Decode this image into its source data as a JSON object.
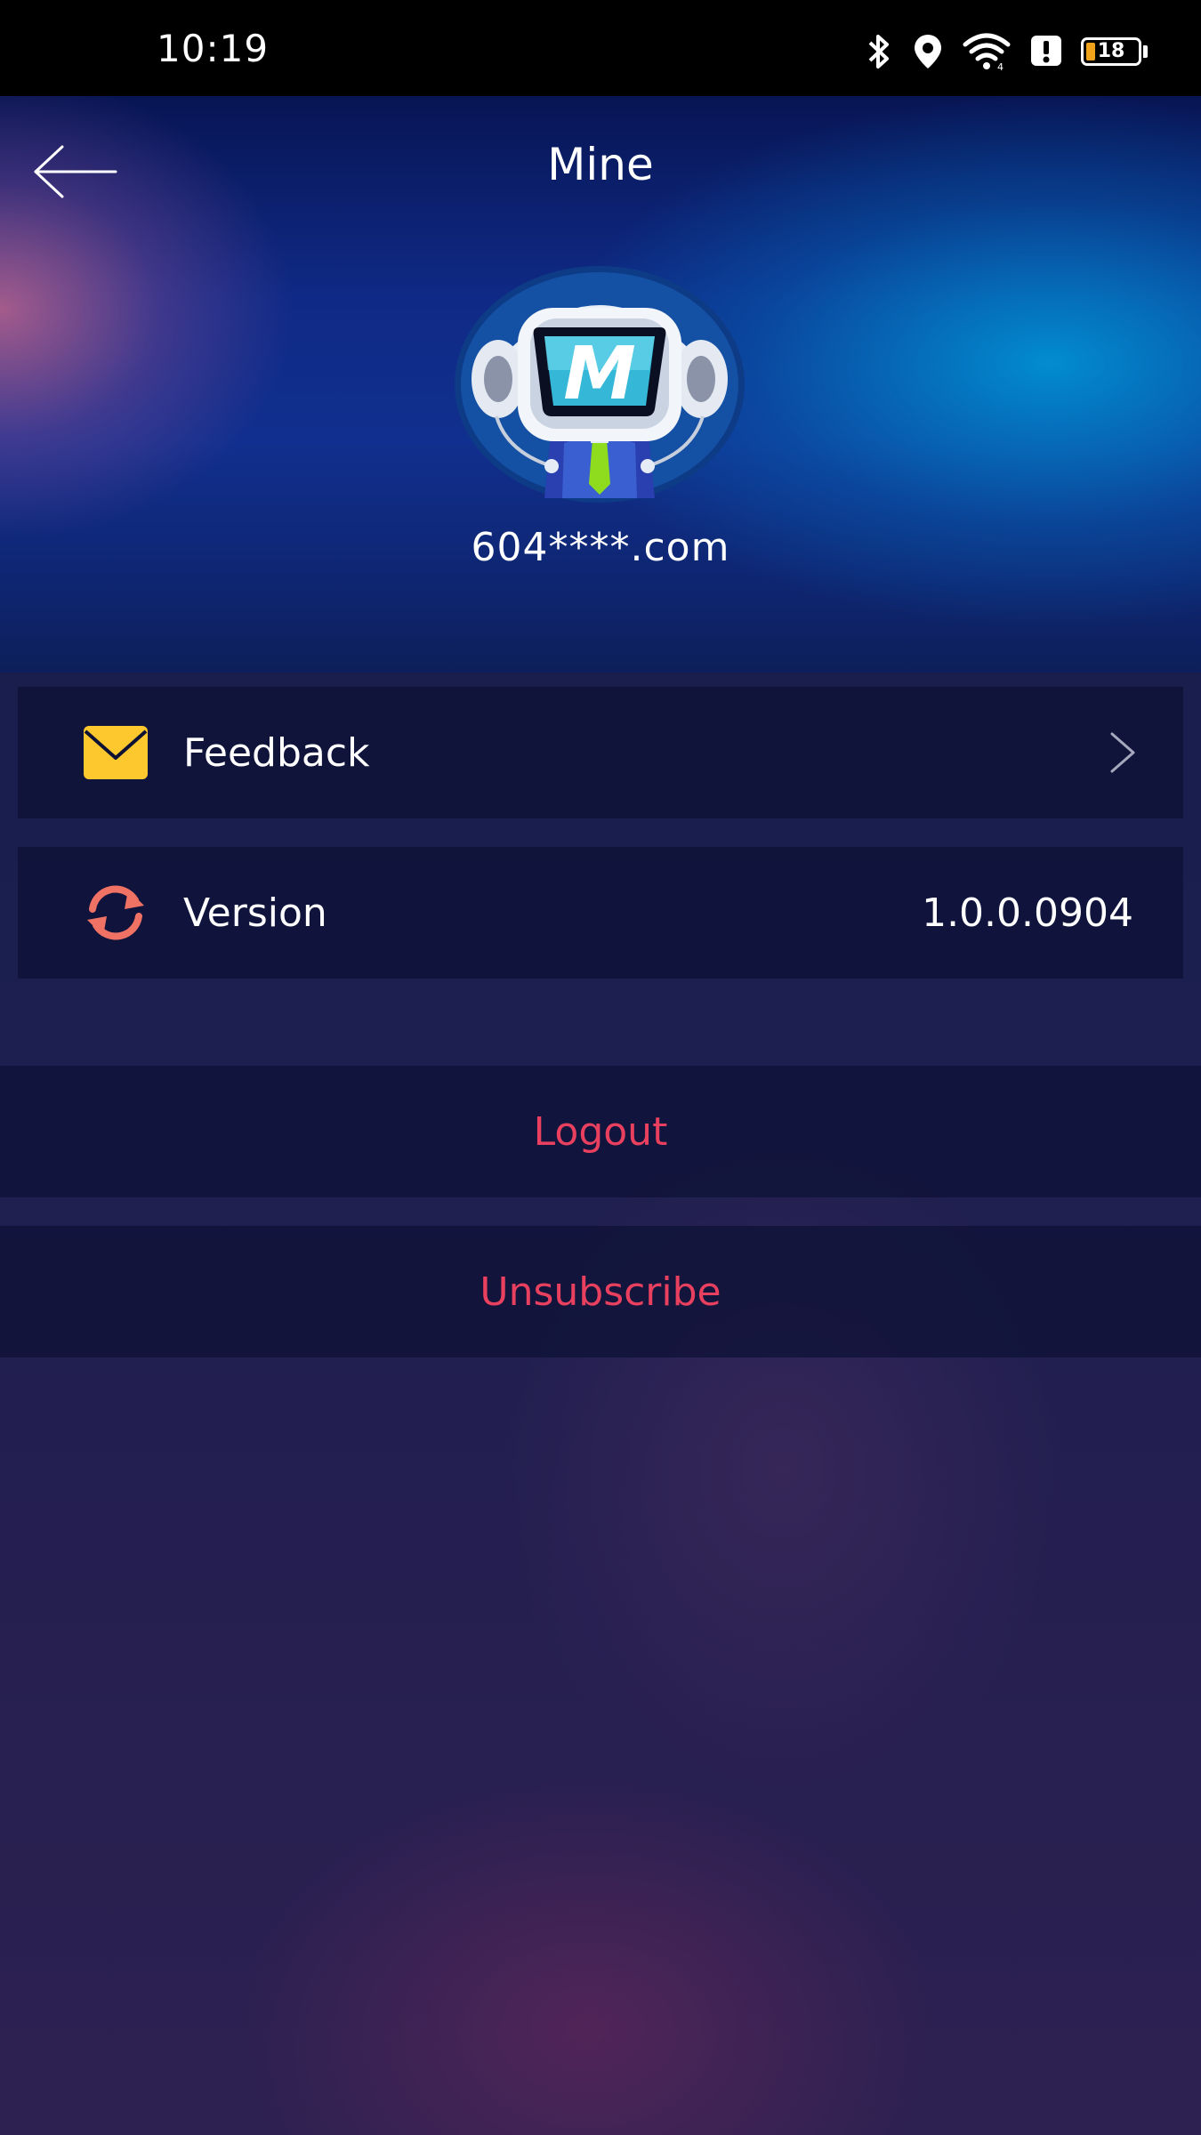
{
  "status_bar": {
    "time": "10:19",
    "battery_level": "18",
    "battery_fraction": 0.18,
    "icons": [
      "bluetooth-icon",
      "location-icon",
      "wifi-icon",
      "notification-alert-icon",
      "battery-icon"
    ]
  },
  "header": {
    "title": "Mine",
    "back_icon": "arrow-left-icon",
    "avatar": "robot-mascot-avatar",
    "avatar_letter": "M",
    "account": "604****.com"
  },
  "menu": {
    "feedback": {
      "label": "Feedback",
      "icon": "envelope-icon",
      "icon_color": "#fcc82d",
      "trailing_icon": "chevron-right-icon"
    },
    "version": {
      "label": "Version",
      "icon": "refresh-icon",
      "icon_color": "#f07265",
      "value": "1.0.0.0904"
    }
  },
  "actions": {
    "logout": "Logout",
    "unsubscribe": "Unsubscribe",
    "color": "#e8405e"
  }
}
